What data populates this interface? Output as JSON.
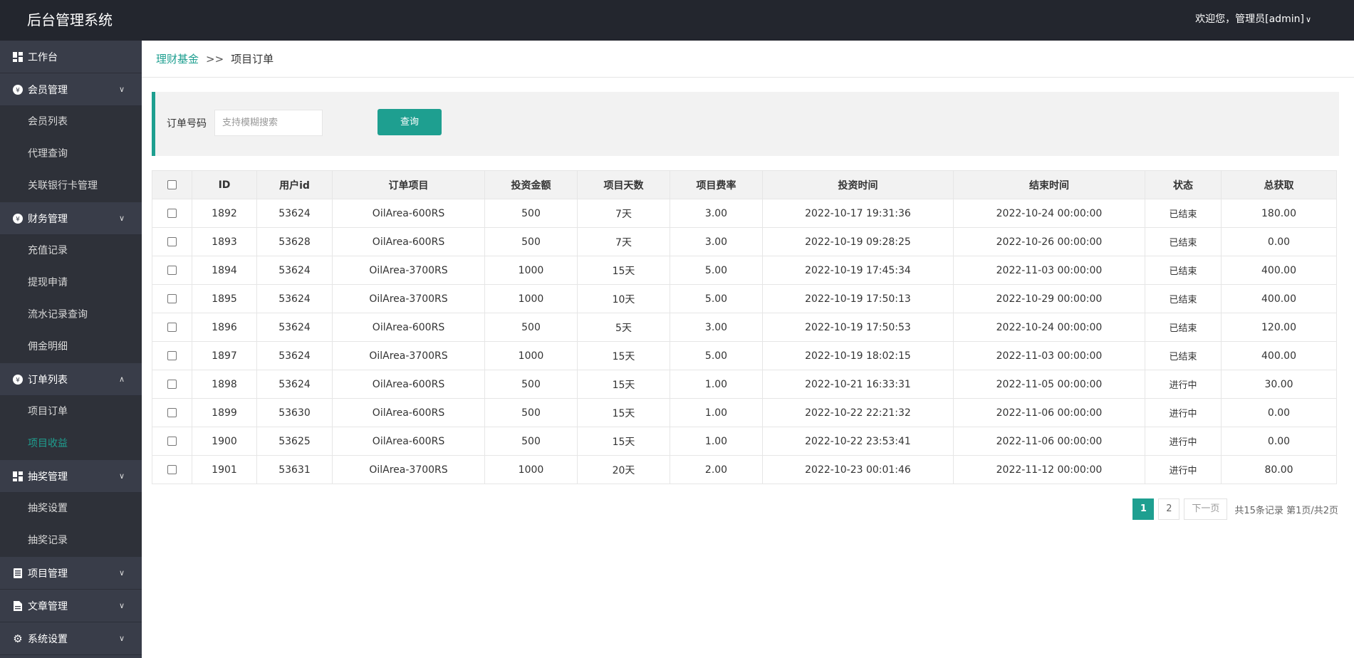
{
  "header": {
    "title": "后台管理系统",
    "user_greeting": "欢迎您，管理员[admin]"
  },
  "sidebar": {
    "workbench": "工作台",
    "groups": [
      {
        "label": "会员管理",
        "icon": "member-icon",
        "expanded": true,
        "items": [
          "会员列表",
          "代理查询",
          "关联银行卡管理"
        ]
      },
      {
        "label": "财务管理",
        "icon": "finance-icon",
        "expanded": true,
        "items": [
          "充值记录",
          "提现申请",
          "流水记录查询",
          "佣金明细"
        ]
      },
      {
        "label": "订单列表",
        "icon": "order-icon",
        "expanded": true,
        "items": [
          "项目订单",
          "项目收益"
        ]
      },
      {
        "label": "抽奖管理",
        "icon": "lottery-icon",
        "expanded": true,
        "items": [
          "抽奖设置",
          "抽奖记录"
        ]
      },
      {
        "label": "项目管理",
        "icon": "project-icon",
        "expanded": false,
        "items": []
      },
      {
        "label": "文章管理",
        "icon": "article-icon",
        "expanded": false,
        "items": []
      },
      {
        "label": "系统设置",
        "icon": "gear-icon",
        "expanded": false,
        "items": []
      }
    ],
    "active_item": "项目收益"
  },
  "breadcrumb": {
    "parent": "理财基金",
    "separator": ">>",
    "current": "项目订单"
  },
  "search": {
    "label": "订单号码",
    "placeholder": "支持模糊搜索",
    "button": "查询"
  },
  "table": {
    "headers": [
      "ID",
      "用户id",
      "订单项目",
      "投资金额",
      "项目天数",
      "项目费率",
      "投资时间",
      "结束时间",
      "状态",
      "总获取"
    ],
    "rows": [
      [
        "1892",
        "53624",
        "OilArea-600RS",
        "500",
        "7天",
        "3.00",
        "2022-10-17 19:31:36",
        "2022-10-24 00:00:00",
        "已结束",
        "180.00"
      ],
      [
        "1893",
        "53628",
        "OilArea-600RS",
        "500",
        "7天",
        "3.00",
        "2022-10-19 09:28:25",
        "2022-10-26 00:00:00",
        "已结束",
        "0.00"
      ],
      [
        "1894",
        "53624",
        "OilArea-3700RS",
        "1000",
        "15天",
        "5.00",
        "2022-10-19 17:45:34",
        "2022-11-03 00:00:00",
        "已结束",
        "400.00"
      ],
      [
        "1895",
        "53624",
        "OilArea-3700RS",
        "1000",
        "10天",
        "5.00",
        "2022-10-19 17:50:13",
        "2022-10-29 00:00:00",
        "已结束",
        "400.00"
      ],
      [
        "1896",
        "53624",
        "OilArea-600RS",
        "500",
        "5天",
        "3.00",
        "2022-10-19 17:50:53",
        "2022-10-24 00:00:00",
        "已结束",
        "120.00"
      ],
      [
        "1897",
        "53624",
        "OilArea-3700RS",
        "1000",
        "15天",
        "5.00",
        "2022-10-19 18:02:15",
        "2022-11-03 00:00:00",
        "已结束",
        "400.00"
      ],
      [
        "1898",
        "53624",
        "OilArea-600RS",
        "500",
        "15天",
        "1.00",
        "2022-10-21 16:33:31",
        "2022-11-05 00:00:00",
        "进行中",
        "30.00"
      ],
      [
        "1899",
        "53630",
        "OilArea-600RS",
        "500",
        "15天",
        "1.00",
        "2022-10-22 22:21:32",
        "2022-11-06 00:00:00",
        "进行中",
        "0.00"
      ],
      [
        "1900",
        "53625",
        "OilArea-600RS",
        "500",
        "15天",
        "1.00",
        "2022-10-22 23:53:41",
        "2022-11-06 00:00:00",
        "进行中",
        "0.00"
      ],
      [
        "1901",
        "53631",
        "OilArea-3700RS",
        "1000",
        "20天",
        "2.00",
        "2022-10-23 00:01:46",
        "2022-11-12 00:00:00",
        "进行中",
        "80.00"
      ]
    ]
  },
  "pagination": {
    "pages": [
      "1",
      "2"
    ],
    "current": "1",
    "next": "下一页",
    "info": "共15条记录 第1页/共2页"
  },
  "colors": {
    "accent": "#1e9f90",
    "topbar": "#23262e",
    "sidebar": "#393d49",
    "sidebar_sub": "#2e3139"
  }
}
